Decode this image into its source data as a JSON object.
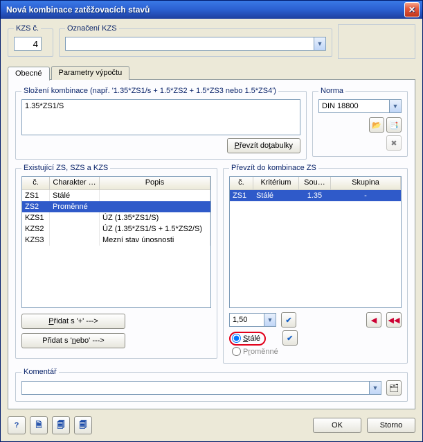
{
  "title": "Nová kombinace zatěžovacích stavů",
  "kzs": {
    "no_label": "KZS č.",
    "no_value": "4",
    "name_label": "Označení KZS",
    "name_value": ""
  },
  "tabs": {
    "general": "Obecné",
    "params": "Parametry výpočtu"
  },
  "composition": {
    "legend": "Složení kombinace (např. '1.35*ZS1/s + 1.5*ZS2 + 1.5*ZS3 nebo 1.5*ZS4')",
    "value": "1.35*ZS1/S",
    "to_table": "Převzít do tabulky"
  },
  "norm": {
    "legend": "Norma",
    "value": "DIN 18800",
    "folder_icon": "folder-open-icon",
    "props_icon": "props-icon",
    "delete_icon": "delete-icon"
  },
  "existing": {
    "legend": "Existující ZS, SZS a KZS",
    "headers": {
      "no": "č.",
      "char": "Charakter …",
      "desc": "Popis"
    },
    "rows": [
      {
        "no": "ZS1",
        "char": "Stálé",
        "desc": ""
      },
      {
        "no": "ZS2",
        "char": "Proměnné",
        "desc": "",
        "selected": true
      },
      {
        "no": "KZS1",
        "char": "",
        "desc": "ÚZ  (1.35*ZS1/S)"
      },
      {
        "no": "KZS2",
        "char": "",
        "desc": "ÚZ  (1.35*ZS1/S + 1.5*ZS2/S)"
      },
      {
        "no": "KZS3",
        "char": "",
        "desc": "Mezní stav únosnosti"
      }
    ],
    "add_plus": "Přidat s '+' --->",
    "add_or": "Přidat s 'nebo' --->"
  },
  "target": {
    "legend": "Převzít do kombinace ZS",
    "headers": {
      "no": "č.",
      "crit": "Kritérium",
      "fac": "Sou…",
      "grp": "Skupina"
    },
    "rows": [
      {
        "no": "ZS1",
        "crit": "Stálé",
        "fac": "1.35",
        "grp": "-",
        "selected": true
      }
    ],
    "factor_value": "1,50",
    "radio_stale": "Stálé",
    "radio_prom": "Proměnné"
  },
  "comment": {
    "legend": "Komentář",
    "value": ""
  },
  "footer": {
    "ok": "OK",
    "cancel": "Storno"
  }
}
